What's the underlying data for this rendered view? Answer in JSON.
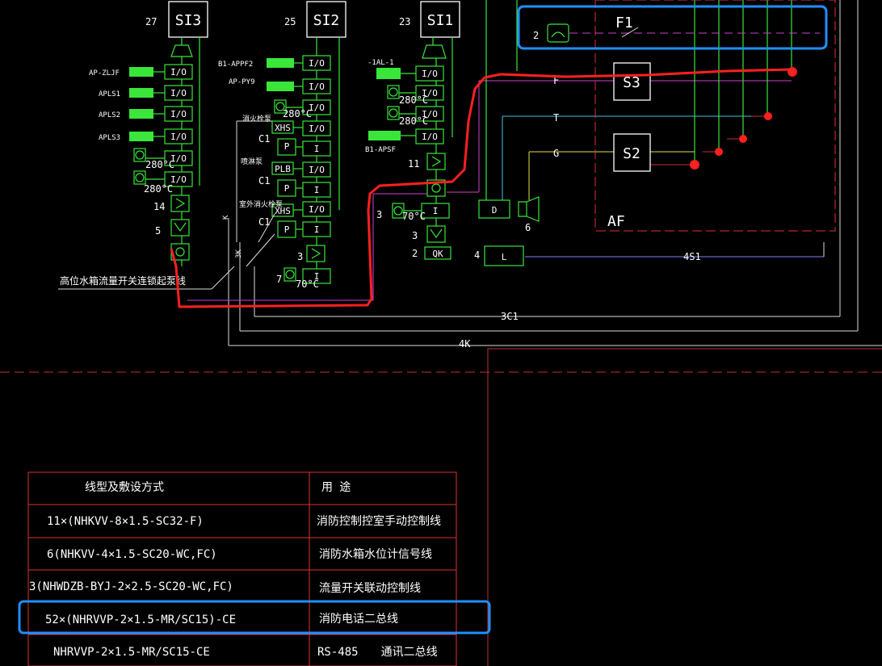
{
  "panels": [
    {
      "num": "27",
      "label": "SI3"
    },
    {
      "num": "25",
      "label": "SI2"
    },
    {
      "num": "23",
      "label": "SI1"
    }
  ],
  "io_label": "I/O",
  "left_tags": [
    "AP-ZLJF",
    "APLS1",
    "APLS2",
    "APLS3"
  ],
  "mid_tags": [
    "B1-APPF2",
    "AP-PY9"
  ],
  "right_tags": [
    "-1AL-1",
    "B1-APSF"
  ],
  "temps": {
    "t280": "280°C",
    "t70": "70°C"
  },
  "modules": {
    "xhs": "XHS",
    "plb": "PLB",
    "p": "P",
    "i": "I",
    "c1": "C1",
    "k": "K",
    "threek": "3K",
    "qk": "QK"
  },
  "small_notes": [
    "消火栓泵",
    "喷淋泵",
    "室外消火栓泵"
  ],
  "counts": {
    "c14": "14",
    "c5": "5",
    "c3": "3",
    "c7": "7",
    "c11": "11",
    "r3a": "3",
    "r3b": "3",
    "r2": "2",
    "n4": "4",
    "n6": "6",
    "n2": "2"
  },
  "callout": "高位水箱流量开关连锁起泵线",
  "right_block": {
    "f1": "F1",
    "f": "F",
    "t": "T",
    "g": "G",
    "s3": "S3",
    "s2": "S2",
    "d": "D",
    "l": "L",
    "af": "AF"
  },
  "bus_labels": {
    "bus4s1": "4S1",
    "bus3c1": "3C1",
    "bus4k": "4K"
  },
  "table": {
    "headers": [
      "线型及敷设方式",
      "用 途"
    ],
    "rows": [
      [
        "11×(NHKVV-8×1.5-SC32-F)",
        "消防控制控室手动控制线"
      ],
      [
        "6(NHKVV-4×1.5-SC20-WC,FC)",
        "消防水箱水位计信号线"
      ],
      [
        "3(NHWDZB-BYJ-2×2.5-SC20-WC,FC)",
        "流量开关联动控制线"
      ],
      [
        "52×(NHRVVP-2×1.5-MR/SC15)-CE",
        "消防电话二总线"
      ],
      [
        "NHRVVP-2×1.5-MR/SC15-CE",
        "RS-485　　通讯二总线"
      ]
    ]
  },
  "colors": {
    "green": "#39e639",
    "red_annot": "#ff2020",
    "blue_annot": "#1e90ff",
    "magenta": "#d040d0",
    "cyan": "#40c8e0",
    "yellow": "#e0e040",
    "dark_red": "#c03030"
  }
}
